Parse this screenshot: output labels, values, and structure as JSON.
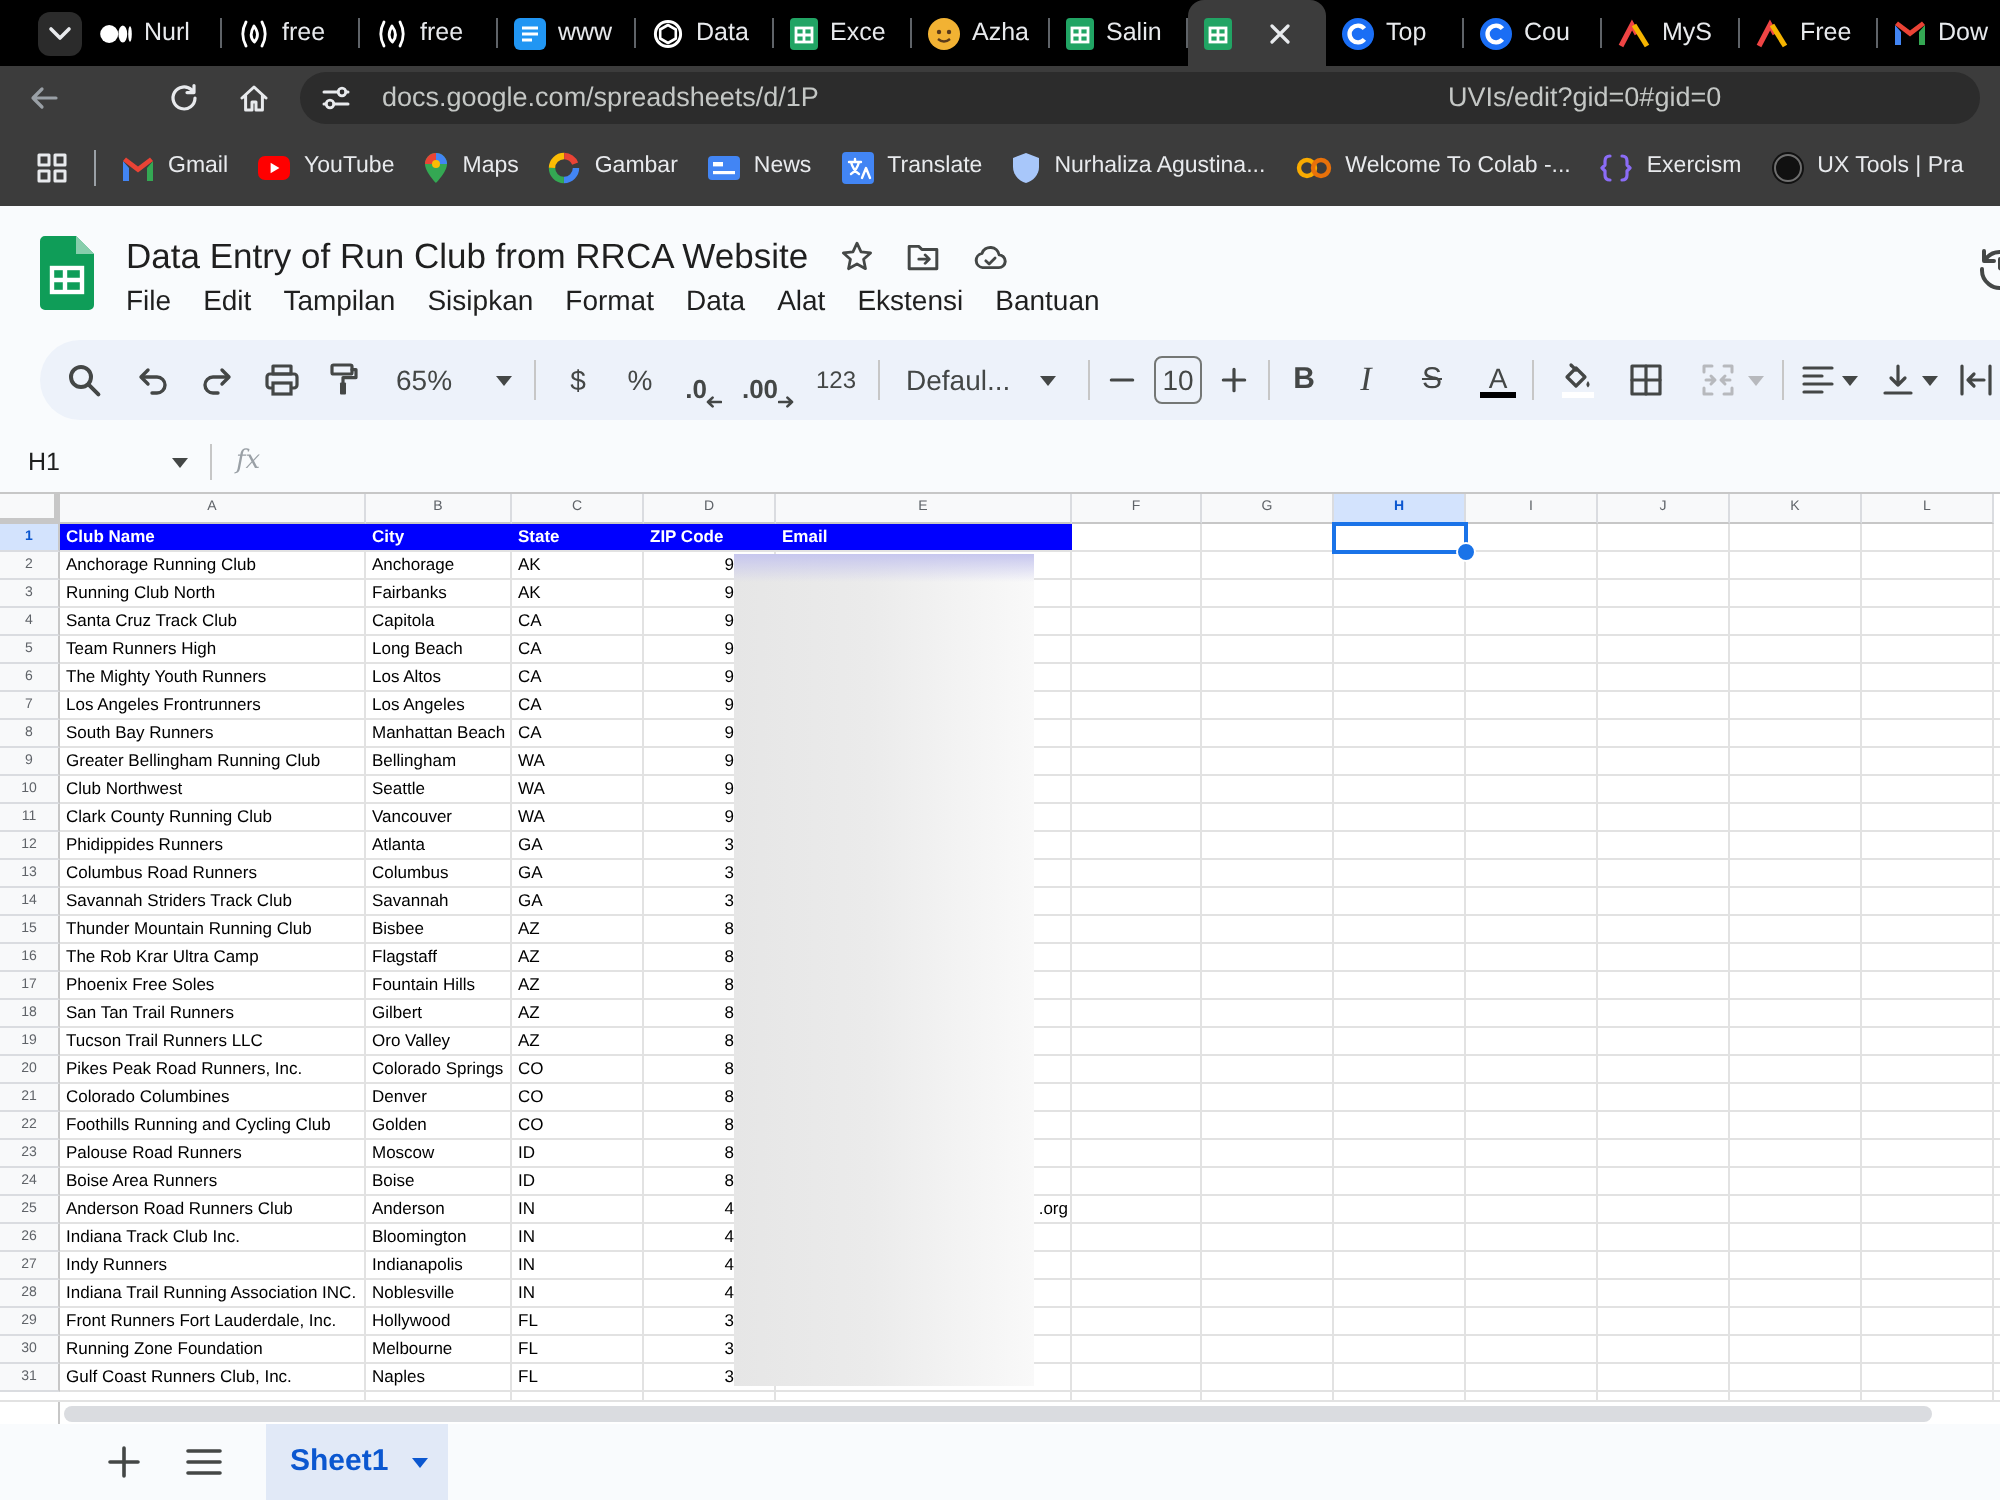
{
  "browser": {
    "tabs": [
      {
        "kind": "ellipses",
        "label": "Nurl",
        "selected": false
      },
      {
        "kind": "arc",
        "label": "free",
        "selected": false
      },
      {
        "kind": "arc",
        "label": "free",
        "selected": false
      },
      {
        "kind": "square",
        "label": "www",
        "selected": false
      },
      {
        "kind": "knot",
        "label": "Data",
        "selected": false
      },
      {
        "kind": "sheet",
        "label": "Exce",
        "selected": false
      },
      {
        "kind": "face",
        "label": "Azha",
        "selected": false
      },
      {
        "kind": "sheet",
        "label": "Salin",
        "selected": false
      },
      {
        "kind": "sheet",
        "selected": true
      },
      {
        "kind": "c",
        "label": "Top",
        "selected": false
      },
      {
        "kind": "c",
        "label": "Cou",
        "selected": false
      },
      {
        "kind": "peak",
        "label": "MyS",
        "selected": false
      },
      {
        "kind": "peak",
        "label": "Free",
        "selected": false
      },
      {
        "kind": "mail",
        "label": "Dow",
        "selected": false
      }
    ],
    "address": {
      "url_start": "docs.google.com/spreadsheets/d/1P",
      "url_end": "UVIs/edit?gid=0#gid=0"
    },
    "bookmarks": [
      {
        "kind": "mail",
        "label": "Gmail"
      },
      {
        "kind": "video",
        "label": "YouTube"
      },
      {
        "kind": "pin",
        "label": "Maps"
      },
      {
        "kind": "ring",
        "label": "Gambar"
      },
      {
        "kind": "news",
        "label": "News"
      },
      {
        "kind": "translate",
        "label": "Translate"
      },
      {
        "kind": "shield",
        "label": "Nurhaliza Agustina..."
      },
      {
        "kind": "rings",
        "label": "Welcome To Colab -..."
      },
      {
        "kind": "braces",
        "label": "Exercism"
      },
      {
        "kind": "disc",
        "label": "UX Tools | Pra"
      }
    ]
  },
  "document": {
    "title": "Data Entry of Run Club from RRCA Website",
    "menu": [
      "File",
      "Edit",
      "Tampilan",
      "Sisipkan",
      "Format",
      "Data",
      "Alat",
      "Ekstensi",
      "Bantuan"
    ]
  },
  "toolbar": {
    "zoom": "65%",
    "currency": "$",
    "percent": "%",
    "decrease_decimal": ".0",
    "increase_decimal": ".00",
    "number_format": "123",
    "font": "Defaul...",
    "font_size": "10",
    "text_styles": [
      {
        "kind": "bold",
        "label": "B"
      },
      {
        "kind": "italic",
        "label": "I"
      },
      {
        "kind": "strikethrough",
        "label": "S"
      },
      {
        "kind": "text-color",
        "label": "A"
      }
    ],
    "merge": {
      "disabled": true
    }
  },
  "formula_bar": {
    "name_box": "H1",
    "label": "fx"
  },
  "sheet": {
    "columns": [
      {
        "label": "A",
        "selected": false
      },
      {
        "label": "B",
        "selected": false
      },
      {
        "label": "C",
        "selected": false
      },
      {
        "label": "D",
        "selected": false
      },
      {
        "label": "E",
        "selected": false
      },
      {
        "label": "F",
        "selected": false
      },
      {
        "label": "G",
        "selected": false
      },
      {
        "label": "H",
        "selected": true
      },
      {
        "label": "I",
        "selected": false
      },
      {
        "label": "J",
        "selected": false
      },
      {
        "label": "K",
        "selected": false
      },
      {
        "label": "L",
        "selected": false
      }
    ],
    "rows": [
      {
        "number": "1",
        "kind": "header",
        "selected": true,
        "cells": [
          "Club Name",
          "City",
          "State",
          "ZIP Code",
          "Email"
        ]
      },
      {
        "number": "2",
        "kind": "data",
        "selected": false,
        "cells": [
          "Anchorage Running Club",
          "Anchorage",
          "AK",
          "9"
        ]
      },
      {
        "number": "3",
        "kind": "data",
        "selected": false,
        "cells": [
          "Running Club North",
          "Fairbanks",
          "AK",
          "9"
        ]
      },
      {
        "number": "4",
        "kind": "data",
        "selected": false,
        "cells": [
          "Santa Cruz Track Club",
          "Capitola",
          "CA",
          "9"
        ]
      },
      {
        "number": "5",
        "kind": "data",
        "selected": false,
        "cells": [
          "Team Runners High",
          "Long Beach",
          "CA",
          "9"
        ]
      },
      {
        "number": "6",
        "kind": "data",
        "selected": false,
        "cells": [
          "The Mighty Youth Runners",
          "Los Altos",
          "CA",
          "9"
        ]
      },
      {
        "number": "7",
        "kind": "data",
        "selected": false,
        "cells": [
          "Los Angeles Frontrunners",
          "Los Angeles",
          "CA",
          "9"
        ]
      },
      {
        "number": "8",
        "kind": "data",
        "selected": false,
        "cells": [
          "South Bay Runners",
          "Manhattan Beach",
          "CA",
          "9"
        ]
      },
      {
        "number": "9",
        "kind": "data",
        "selected": false,
        "cells": [
          "Greater Bellingham Running Club",
          "Bellingham",
          "WA",
          "9"
        ]
      },
      {
        "number": "10",
        "kind": "data",
        "selected": false,
        "cells": [
          "Club Northwest",
          "Seattle",
          "WA",
          "9"
        ]
      },
      {
        "number": "11",
        "kind": "data",
        "selected": false,
        "cells": [
          "Clark County Running Club",
          "Vancouver",
          "WA",
          "9"
        ]
      },
      {
        "number": "12",
        "kind": "data",
        "selected": false,
        "cells": [
          "Phidippides Runners",
          "Atlanta",
          "GA",
          "3"
        ]
      },
      {
        "number": "13",
        "kind": "data",
        "selected": false,
        "cells": [
          "Columbus Road Runners",
          "Columbus",
          "GA",
          "3"
        ]
      },
      {
        "number": "14",
        "kind": "data",
        "selected": false,
        "cells": [
          "Savannah Striders Track Club",
          "Savannah",
          "GA",
          "3"
        ]
      },
      {
        "number": "15",
        "kind": "data",
        "selected": false,
        "cells": [
          "Thunder Mountain Running Club",
          "Bisbee",
          "AZ",
          "8"
        ]
      },
      {
        "number": "16",
        "kind": "data",
        "selected": false,
        "cells": [
          "The Rob Krar Ultra Camp",
          "Flagstaff",
          "AZ",
          "8"
        ]
      },
      {
        "number": "17",
        "kind": "data",
        "selected": false,
        "cells": [
          "Phoenix Free Soles",
          "Fountain Hills",
          "AZ",
          "8"
        ]
      },
      {
        "number": "18",
        "kind": "data",
        "selected": false,
        "cells": [
          "San Tan Trail Runners",
          "Gilbert",
          "AZ",
          "8"
        ]
      },
      {
        "number": "19",
        "kind": "data",
        "selected": false,
        "cells": [
          "Tucson Trail Runners LLC",
          "Oro Valley",
          "AZ",
          "8"
        ]
      },
      {
        "number": "20",
        "kind": "data",
        "selected": false,
        "cells": [
          "Pikes Peak Road Runners, Inc.",
          "Colorado Springs",
          "CO",
          "8"
        ]
      },
      {
        "number": "21",
        "kind": "data",
        "selected": false,
        "cells": [
          "Colorado Columbines",
          "Denver",
          "CO",
          "8"
        ]
      },
      {
        "number": "22",
        "kind": "data",
        "selected": false,
        "cells": [
          "Foothills Running and Cycling Club",
          "Golden",
          "CO",
          "8"
        ]
      },
      {
        "number": "23",
        "kind": "data",
        "selected": false,
        "cells": [
          "Palouse Road Runners",
          "Moscow",
          "ID",
          "8"
        ]
      },
      {
        "number": "24",
        "kind": "data",
        "selected": false,
        "cells": [
          "Boise Area Runners",
          "Boise",
          "ID",
          "8"
        ]
      },
      {
        "number": "25",
        "kind": "data",
        "selected": false,
        "cells": [
          "Anderson Road Runners Club",
          "Anderson",
          "IN",
          "4",
          ".org"
        ]
      },
      {
        "number": "26",
        "kind": "data",
        "selected": false,
        "cells": [
          "Indiana Track Club Inc.",
          "Bloomington",
          "IN",
          "4"
        ]
      },
      {
        "number": "27",
        "kind": "data",
        "selected": false,
        "cells": [
          "Indy Runners",
          "Indianapolis",
          "IN",
          "4"
        ]
      },
      {
        "number": "28",
        "kind": "data",
        "selected": false,
        "cells": [
          "Indiana Trail Running Association INC.",
          "Noblesville",
          "IN",
          "4"
        ]
      },
      {
        "number": "29",
        "kind": "data",
        "selected": false,
        "cells": [
          "Front Runners Fort Lauderdale, Inc.",
          "Hollywood",
          "FL",
          "3"
        ]
      },
      {
        "number": "30",
        "kind": "data",
        "selected": false,
        "cells": [
          "Running Zone Foundation",
          "Melbourne",
          "FL",
          "3"
        ]
      },
      {
        "number": "31",
        "kind": "data",
        "selected": false,
        "cells": [
          "Gulf Coast Runners Club, Inc.",
          "Naples",
          "FL",
          "3"
        ]
      }
    ],
    "blurred_region": true,
    "sheet_tabs": [
      {
        "label": "Sheet1",
        "selected": true
      }
    ]
  }
}
